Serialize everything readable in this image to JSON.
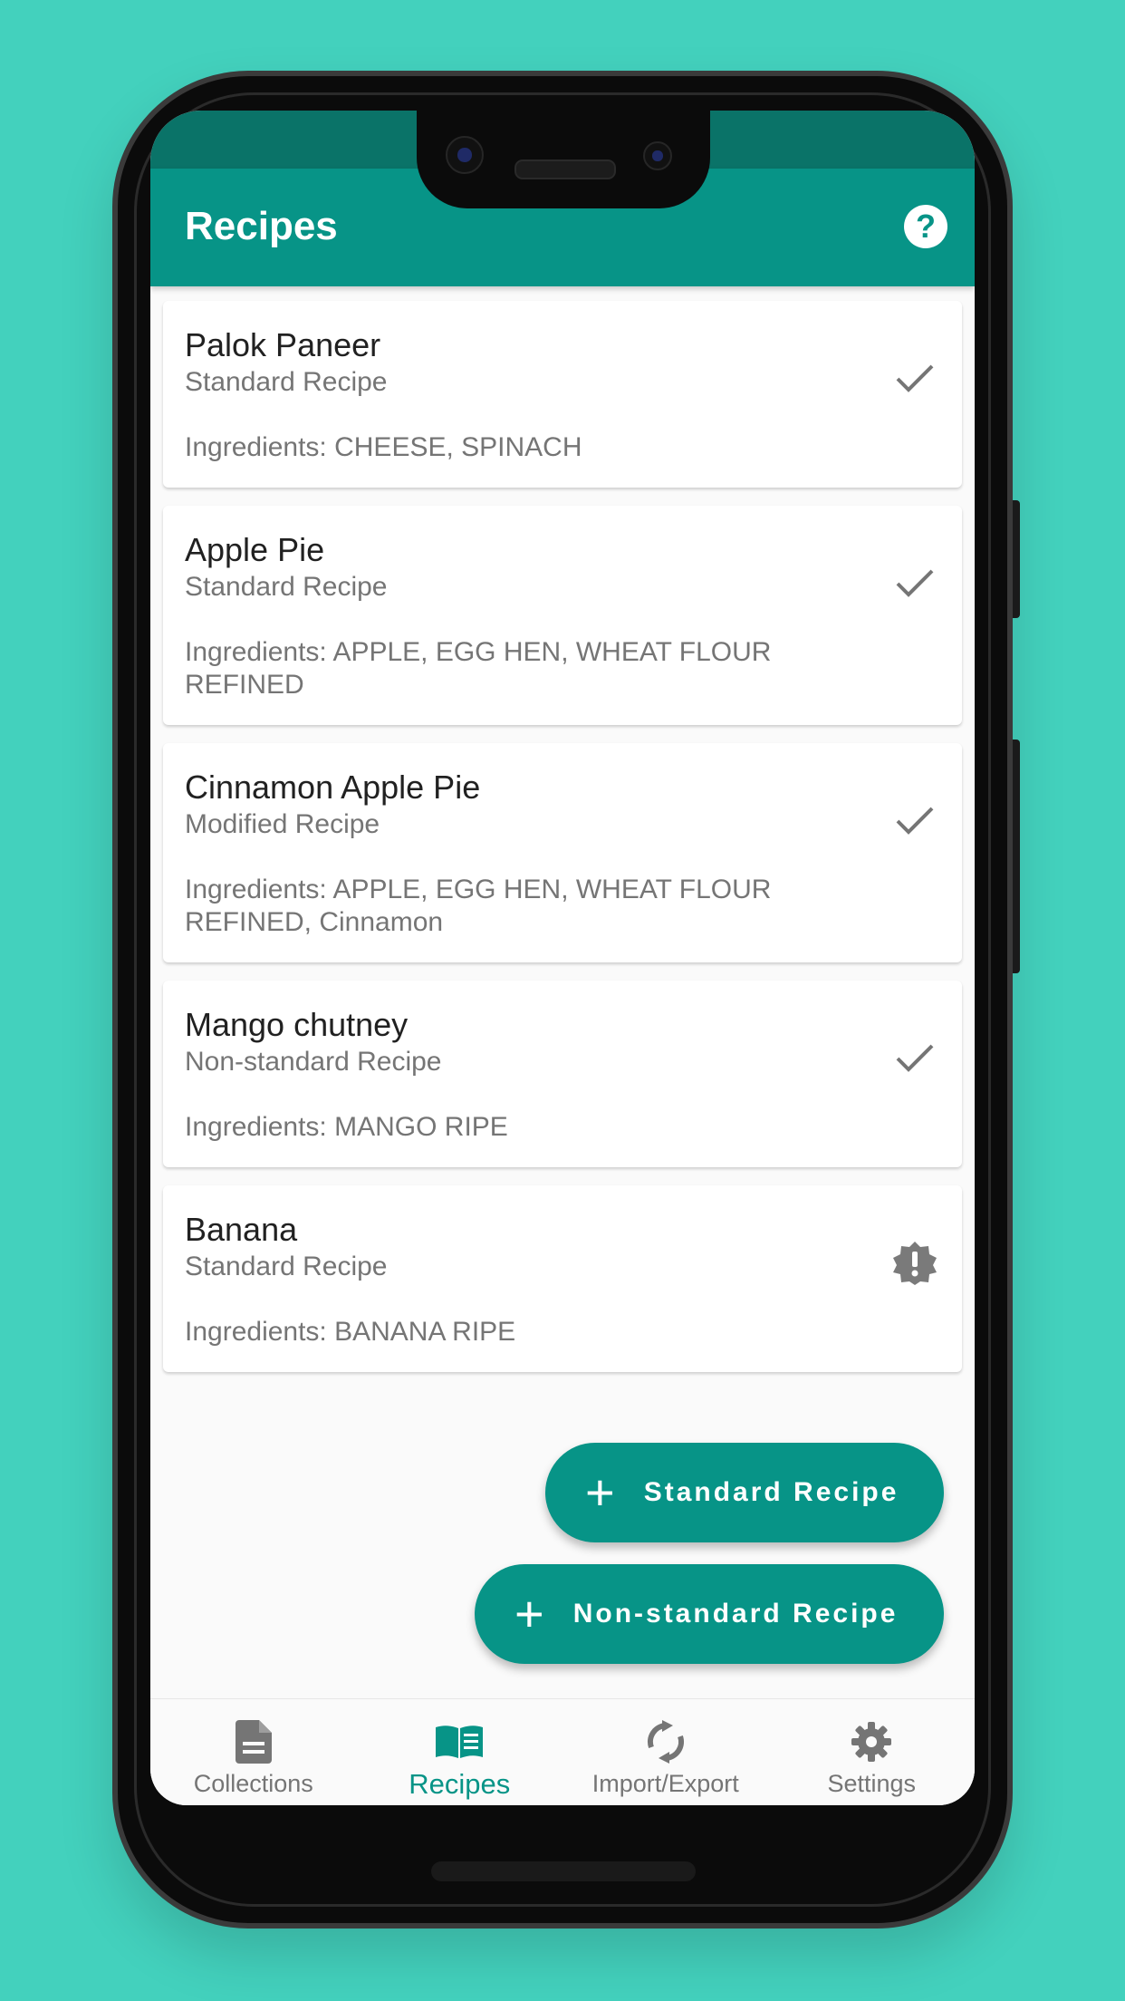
{
  "app_bar": {
    "title": "Recipes",
    "help_icon": "help-circle-icon",
    "color": "#079487"
  },
  "recipes": [
    {
      "title": "Palok Paneer",
      "type": "Standard Recipe",
      "ingredients": "Ingredients: CHEESE, SPINACH",
      "status_icon": "check-icon"
    },
    {
      "title": "Apple Pie",
      "type": "Standard Recipe",
      "ingredients": "Ingredients: APPLE, EGG HEN, WHEAT FLOUR REFINED",
      "status_icon": "check-icon"
    },
    {
      "title": "Cinnamon Apple Pie",
      "type": "Modified Recipe",
      "ingredients": "Ingredients: APPLE, EGG HEN, WHEAT FLOUR REFINED, Cinnamon",
      "status_icon": "check-icon"
    },
    {
      "title": "Mango chutney",
      "type": "Non-standard Recipe",
      "ingredients": "Ingredients: MANGO RIPE",
      "status_icon": "check-icon"
    },
    {
      "title": "Banana",
      "type": "Standard Recipe",
      "ingredients": "Ingredients: BANANA RIPE",
      "status_icon": "warning-badge-icon"
    }
  ],
  "fabs": {
    "standard": {
      "label": "Standard Recipe",
      "icon": "plus-icon"
    },
    "nonstandard": {
      "label": "Non-standard Recipe",
      "icon": "plus-icon"
    }
  },
  "bottom_nav": [
    {
      "label": "Collections",
      "icon": "document-icon",
      "active": false
    },
    {
      "label": "Recipes",
      "icon": "open-book-icon",
      "active": true
    },
    {
      "label": "Import/Export",
      "icon": "sync-icon",
      "active": false
    },
    {
      "label": "Settings",
      "icon": "gear-icon",
      "active": false
    }
  ],
  "colors": {
    "background": "#43d1bd",
    "primary": "#079487",
    "status_bar": "#0a7368",
    "inactive": "#757575"
  }
}
